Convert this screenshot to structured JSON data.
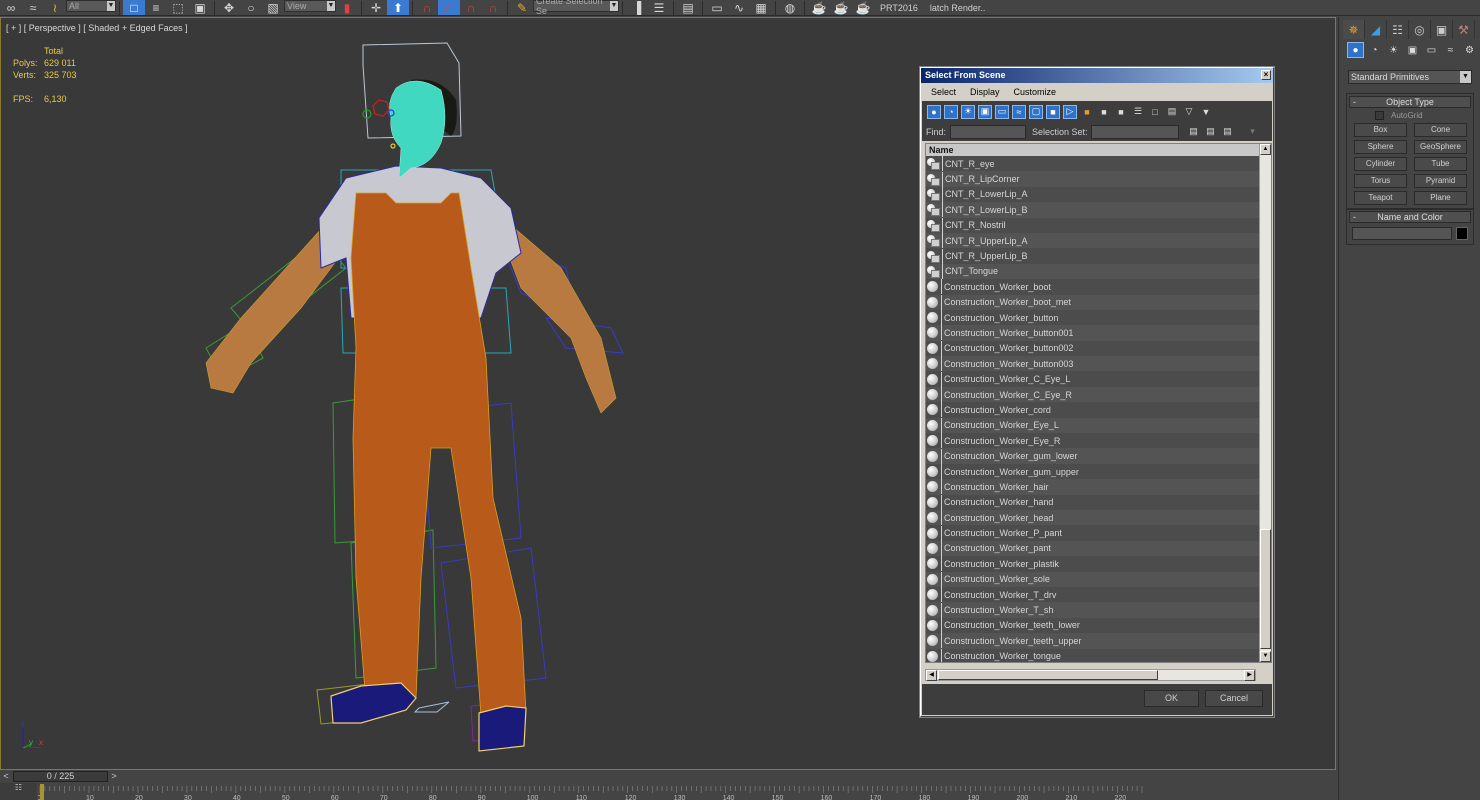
{
  "toolbar": {
    "selection_filter": "All",
    "ref_coord": "View",
    "named_selection": "Create Selection Se",
    "plugin_label": "PRT2016",
    "batch_render_label": "latch Render..",
    "icons": [
      "link-icon",
      "unlink-icon",
      "bind-space-warp-icon",
      "select-object-icon",
      "select-by-name-icon",
      "rect-selection-region-icon",
      "window-crossing-icon",
      "select-move-icon",
      "select-rotate-icon",
      "select-scale-icon",
      "select-manipulate-icon",
      "pivot-icon",
      "keyboard-shortcut-override-icon",
      "snaps-toggle-icon",
      "angle-snap-icon",
      "percent-snap-icon",
      "spinner-snap-icon",
      "edit-named-selection-icon",
      "mirror-icon",
      "align-icon",
      "layer-explorer-icon",
      "toggle-ribbon-icon",
      "curve-editor-icon",
      "schematic-view-icon",
      "material-editor-icon",
      "render-setup-icon",
      "rendered-frame-window-icon",
      "render-icon"
    ]
  },
  "viewport": {
    "label": "[ + ] [ Perspective ] [ Shaded + Edged Faces ]",
    "stats": {
      "header": "Total",
      "polys_label": "Polys:",
      "polys": "629 011",
      "verts_label": "Verts:",
      "verts": "325 703",
      "fps_label": "FPS:",
      "fps": "6,130"
    },
    "axis": {
      "z": "z",
      "y": "y",
      "x": "x"
    }
  },
  "dialog": {
    "title": "Select From Scene",
    "close": "×",
    "menu": [
      "Select",
      "Display",
      "Customize"
    ],
    "find_label": "Find:",
    "find_value": "",
    "selection_set_label": "Selection Set:",
    "selection_set_value": "",
    "column_header": "Name",
    "items": [
      {
        "name": "CNT_R_eye",
        "type": "shape"
      },
      {
        "name": "CNT_R_LipCorner",
        "type": "shape"
      },
      {
        "name": "CNT_R_LowerLip_A",
        "type": "shape"
      },
      {
        "name": "CNT_R_LowerLip_B",
        "type": "shape"
      },
      {
        "name": "CNT_R_Nostril",
        "type": "shape"
      },
      {
        "name": "CNT_R_UpperLip_A",
        "type": "shape"
      },
      {
        "name": "CNT_R_UpperLip_B",
        "type": "shape"
      },
      {
        "name": "CNT_Tongue",
        "type": "shape"
      },
      {
        "name": "Construction_Worker_boot",
        "type": "geometry"
      },
      {
        "name": "Construction_Worker_boot_met",
        "type": "geometry"
      },
      {
        "name": "Construction_Worker_button",
        "type": "geometry"
      },
      {
        "name": "Construction_Worker_button001",
        "type": "geometry"
      },
      {
        "name": "Construction_Worker_button002",
        "type": "geometry"
      },
      {
        "name": "Construction_Worker_button003",
        "type": "geometry"
      },
      {
        "name": "Construction_Worker_C_Eye_L",
        "type": "geometry"
      },
      {
        "name": "Construction_Worker_C_Eye_R",
        "type": "geometry"
      },
      {
        "name": "Construction_Worker_cord",
        "type": "geometry"
      },
      {
        "name": "Construction_Worker_Eye_L",
        "type": "geometry"
      },
      {
        "name": "Construction_Worker_Eye_R",
        "type": "geometry"
      },
      {
        "name": "Construction_Worker_gum_lower",
        "type": "geometry"
      },
      {
        "name": "Construction_Worker_gum_upper",
        "type": "geometry"
      },
      {
        "name": "Construction_Worker_hair",
        "type": "geometry"
      },
      {
        "name": "Construction_Worker_hand",
        "type": "geometry"
      },
      {
        "name": "Construction_Worker_head",
        "type": "geometry"
      },
      {
        "name": "Construction_Worker_P_pant",
        "type": "geometry"
      },
      {
        "name": "Construction_Worker_pant",
        "type": "geometry"
      },
      {
        "name": "Construction_Worker_plastik",
        "type": "geometry"
      },
      {
        "name": "Construction_Worker_sole",
        "type": "geometry"
      },
      {
        "name": "Construction_Worker_T_drv",
        "type": "geometry"
      },
      {
        "name": "Construction_Worker_T_sh",
        "type": "geometry"
      },
      {
        "name": "Construction_Worker_teeth_lower",
        "type": "geometry"
      },
      {
        "name": "Construction_Worker_teeth_upper",
        "type": "geometry"
      },
      {
        "name": "Construction_Worker_tongue",
        "type": "geometry"
      }
    ],
    "ok_label": "OK",
    "cancel_label": "Cancel"
  },
  "command_panel": {
    "category": "Standard Primitives",
    "object_type_title": "Object Type",
    "autogrid_label": "AutoGrid",
    "autogrid_checked": false,
    "primitives": [
      "Box",
      "Cone",
      "Sphere",
      "GeoSphere",
      "Cylinder",
      "Tube",
      "Torus",
      "Pyramid",
      "Teapot",
      "Plane"
    ],
    "name_color_title": "Name and Color",
    "object_name": "",
    "object_color": "#000000",
    "collapse_glyph": "-"
  },
  "timeline": {
    "prev": "<",
    "next": ">",
    "frame_display": "0 / 225",
    "current_frame": 0,
    "total_frames": 225,
    "ticks": [
      "0",
      "10",
      "20",
      "30",
      "40",
      "50",
      "60",
      "70",
      "80",
      "90",
      "100",
      "110",
      "120",
      "130",
      "140",
      "150",
      "160",
      "170",
      "180",
      "190",
      "200",
      "210",
      "220"
    ]
  }
}
